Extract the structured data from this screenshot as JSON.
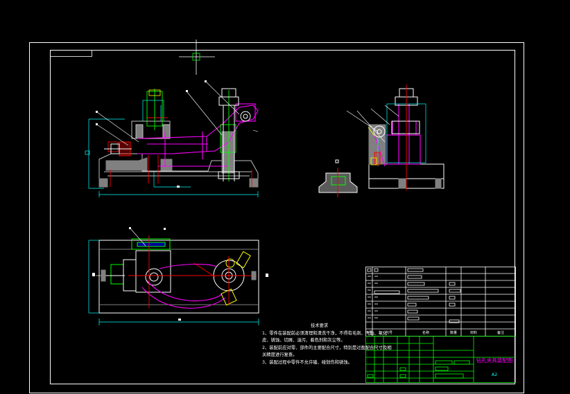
{
  "drawing": {
    "background": "#000000",
    "colors": {
      "frame": "#ffffff",
      "body": "#808080",
      "magenta": "#ff00ff",
      "cyan": "#00ffff",
      "green": "#00ff00",
      "red": "#ff0000",
      "yellow": "#ffff00",
      "blue": "#0000ff"
    },
    "views": [
      "front-view",
      "side-view",
      "base-section",
      "top-view",
      "title-block"
    ]
  },
  "notes": {
    "heading": "技术要求",
    "lines": [
      "1、零件在装配前必须清理和清洗干净，不得有毛刺、飞边、氧化",
      "皮、锈蚀、切屑、油污、着色剂和灰尘等。",
      "2、装配前应对零、部件的主要配合尺寸，特别是过盈配合尺寸及相",
      "关精度进行复查。",
      "3、装配过程中零件不允许磕、碰划伤和锈蚀。"
    ]
  },
  "title_block": {
    "title": "钻孔夹具装配图",
    "drawing_no": "A2",
    "header_cells": [
      "序号",
      "代号",
      "名称",
      "数量",
      "材料",
      "备注"
    ]
  }
}
